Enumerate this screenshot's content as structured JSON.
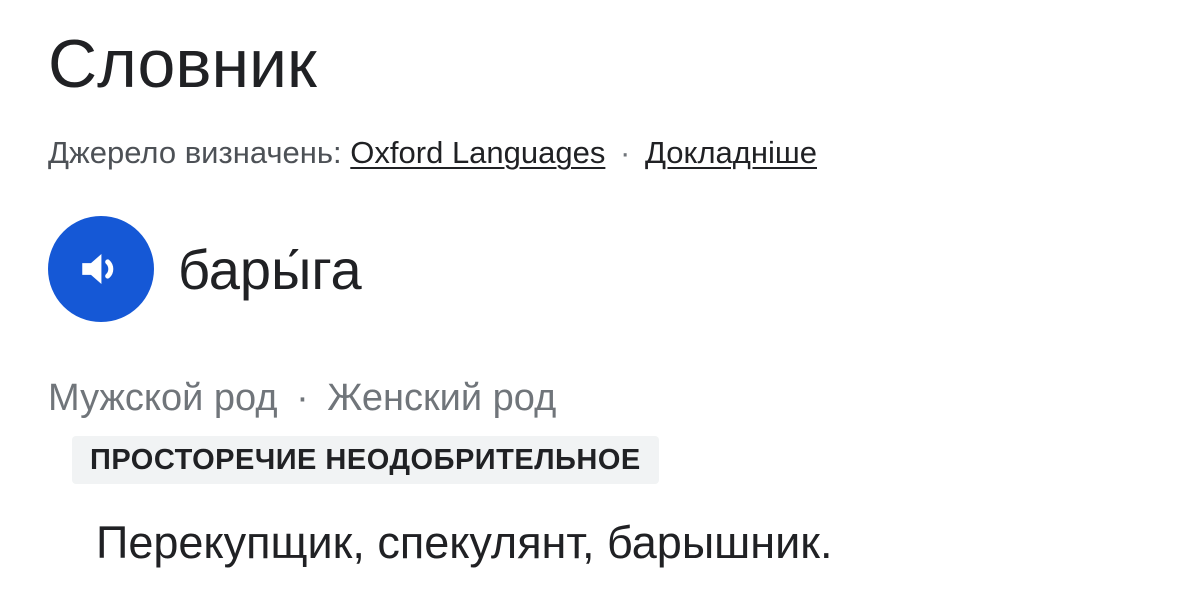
{
  "title": "Словник",
  "source": {
    "prefix": "Джерело визначень:",
    "provider_link": "Oxford Languages",
    "separator": "·",
    "more_link": "Докладніше"
  },
  "entry": {
    "pronounce_icon": "speaker-icon",
    "headword": "бары́га",
    "gender_masculine": "Мужской род",
    "gender_separator": "·",
    "gender_feminine": "Женский род",
    "label": "ПРОСТОРЕЧИЕ НЕОДОБРИТЕЛЬНОЕ",
    "definition": "Перекупщик, спекулянт, барышник."
  },
  "colors": {
    "accent": "#1558d6",
    "badge_bg": "#f1f3f4",
    "secondary_text": "#70757a",
    "primary_text": "#202124"
  }
}
